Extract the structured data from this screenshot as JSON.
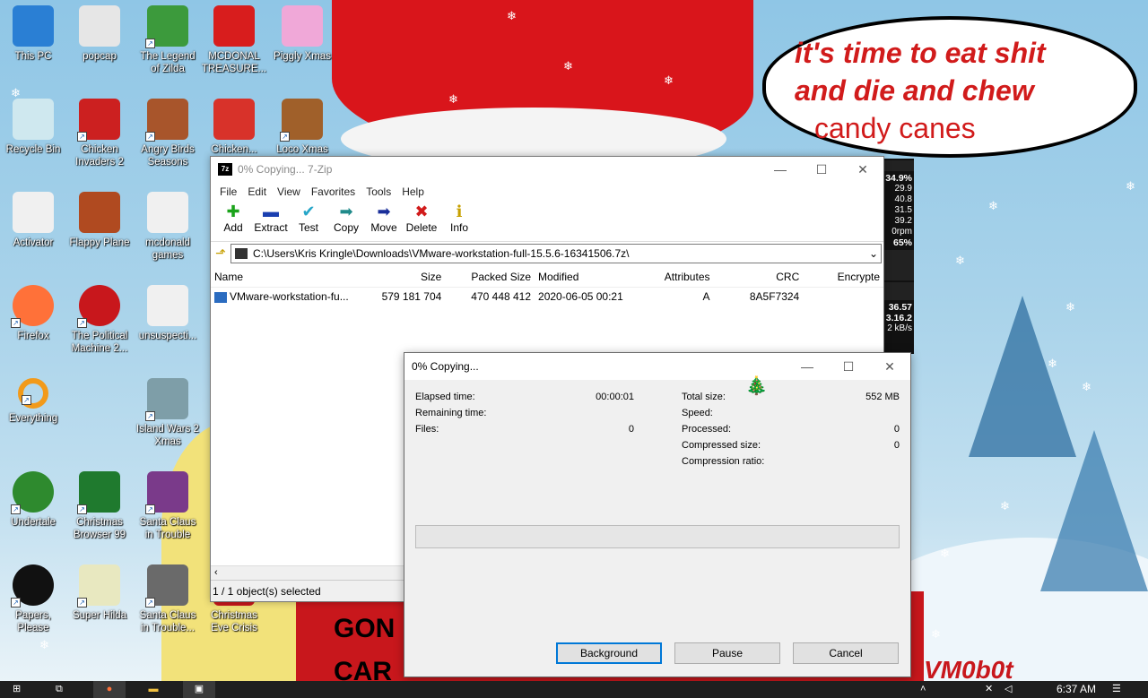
{
  "desktop": {
    "speech_bubble": {
      "line1": "it's time to eat shit",
      "line2": "and die and chew",
      "line3": "candy canes"
    },
    "shirt_text": {
      "line1": "GON",
      "line2": "CAR"
    },
    "watermark": "VM0b0t",
    "icons": [
      {
        "label": "This PC",
        "icon": "computer-icon",
        "color": "#2a7fd4"
      },
      {
        "label": "popcap",
        "icon": "folder-icon",
        "color": "#e6e6e6"
      },
      {
        "label": "The Legend of Zilda",
        "icon": "game-icon",
        "color": "#3c9a3c"
      },
      {
        "label": "MCDONAL TREASURE...",
        "icon": "mcdonalds-icon",
        "color": "#d81d1d"
      },
      {
        "label": "Piggly Xmas",
        "icon": "pig-icon",
        "color": "#f0a8d8"
      },
      {
        "label": "Recycle Bin",
        "icon": "recycle-bin-icon",
        "color": "#cfe8ef"
      },
      {
        "label": "Chicken Invaders 2",
        "icon": "chicken-icon",
        "color": "#cc2020"
      },
      {
        "label": "Angry Birds Seasons",
        "icon": "angry-birds-icon",
        "color": "#a8552b"
      },
      {
        "label": "Chicken...",
        "icon": "snowman-icon",
        "color": "#d8322a"
      },
      {
        "label": "Loco Xmas",
        "icon": "bear-icon",
        "color": "#a0602a"
      },
      {
        "label": "Activator",
        "icon": "file-icon",
        "color": "#f0f0f0"
      },
      {
        "label": "Flappy Plane",
        "icon": "plane-icon",
        "color": "#b04a20"
      },
      {
        "label": "mcdonald games",
        "icon": "file-icon",
        "color": "#f0f0f0"
      },
      {
        "label": "Firefox",
        "icon": "firefox-icon",
        "color": "#ff7139"
      },
      {
        "label": "The Political Machine 2...",
        "icon": "political-icon",
        "color": "#c8171c"
      },
      {
        "label": "unsuspecti...",
        "icon": "file-icon",
        "color": "#f0f0f0"
      },
      {
        "label": "Everything",
        "icon": "magnifier-icon",
        "color": "#f29a1a"
      },
      {
        "label": "Island Wars 2 Xmas",
        "icon": "island-icon",
        "color": "#7e9ea8"
      },
      {
        "label": "Undertale",
        "icon": "undertale-icon",
        "color": "#2e8a2e"
      },
      {
        "label": "Christmas Browser 99",
        "icon": "tree-icon",
        "color": "#1f7a2e"
      },
      {
        "label": "Santa Claus in Trouble",
        "icon": "santa-icon",
        "color": "#7a3a8a"
      },
      {
        "label": "Papers, Please",
        "icon": "papers-icon",
        "color": "#111111"
      },
      {
        "label": "Super Hilda",
        "icon": "hilda-icon",
        "color": "#e8e8c0"
      },
      {
        "label": "Santa Claus in Trouble...",
        "icon": "santa-icon",
        "color": "#6a6a6a"
      },
      {
        "label": "Christmas Eve Crisis",
        "icon": "christmas-icon",
        "color": "#c8171c"
      }
    ]
  },
  "monitor": {
    "l1": "34.9%",
    "l2": "29.9",
    "l3": "40.8",
    "l4": "31.5",
    "l5": "39.2",
    "l6": "0rpm",
    "l7": "65%",
    "l8": "36.57",
    "l9": "3.16.2",
    "l10": "2 kB/s"
  },
  "sevenzip": {
    "title": "0% Copying... 7-Zip",
    "menu": [
      "File",
      "Edit",
      "View",
      "Favorites",
      "Tools",
      "Help"
    ],
    "toolbar": [
      {
        "label": "Add",
        "glyph": "✚",
        "color": "#1aa31a"
      },
      {
        "label": "Extract",
        "glyph": "▬",
        "color": "#1a3fb0"
      },
      {
        "label": "Test",
        "glyph": "✔",
        "color": "#26a6c8"
      },
      {
        "label": "Copy",
        "glyph": "➡",
        "color": "#1f8a8a"
      },
      {
        "label": "Move",
        "glyph": "➡",
        "color": "#1a2f9a"
      },
      {
        "label": "Delete",
        "glyph": "✖",
        "color": "#d11b1b"
      },
      {
        "label": "Info",
        "glyph": "ℹ",
        "color": "#c7a000"
      }
    ],
    "path": "C:\\Users\\Kris Kringle\\Downloads\\VMware-workstation-full-15.5.6-16341506.7z\\",
    "columns": [
      "Name",
      "Size",
      "Packed Size",
      "Modified",
      "Attributes",
      "CRC",
      "Encrypte"
    ],
    "rows": [
      {
        "name": "VMware-workstation-fu...",
        "size": "579 181 704",
        "packed": "470 448 412",
        "modified": "2020-06-05 00:21",
        "attributes": "A",
        "crc": "8A5F7324",
        "encrypted": ""
      }
    ],
    "status": "1 / 1 object(s) selected"
  },
  "dialog": {
    "title": "0% Copying...",
    "elapsed_label": "Elapsed time:",
    "elapsed_value": "00:00:01",
    "remaining_label": "Remaining time:",
    "remaining_value": "",
    "files_label": "Files:",
    "files_value": "0",
    "total_label": "Total size:",
    "total_value": "552 MB",
    "speed_label": "Speed:",
    "speed_value": "",
    "processed_label": "Processed:",
    "processed_value": "0",
    "compressed_label": "Compressed size:",
    "compressed_value": "0",
    "ratio_label": "Compression ratio:",
    "ratio_value": "",
    "progress_fraction": 0,
    "background_label": "Background",
    "pause_label": "Pause",
    "cancel_label": "Cancel"
  },
  "taskbar": {
    "clock": "6:37 AM"
  }
}
